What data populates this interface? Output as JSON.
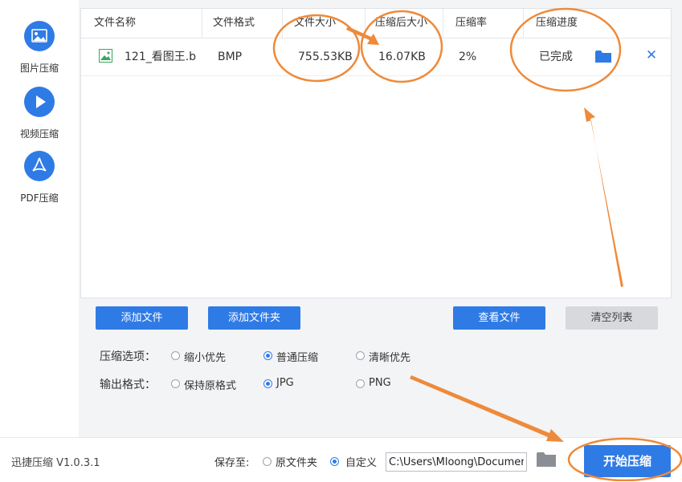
{
  "sidebar": {
    "items": [
      {
        "label": "图片压缩",
        "icon": "image-icon",
        "active": true
      },
      {
        "label": "视频压缩",
        "icon": "play-icon"
      },
      {
        "label": "PDF压缩",
        "icon": "pdf-icon"
      }
    ]
  },
  "table": {
    "headers": [
      "文件名称",
      "文件格式",
      "文件大小",
      "压缩后大小",
      "压缩率",
      "压缩进度"
    ],
    "rows": [
      {
        "name": "121_看图王.b",
        "format": "BMP",
        "size": "755.53KB",
        "compressed_size": "16.07KB",
        "ratio": "2%",
        "status": "已完成"
      }
    ]
  },
  "buttons": {
    "add_file": "添加文件",
    "add_folder": "添加文件夹",
    "view_files": "查看文件",
    "clear_list": "清空列表"
  },
  "options": {
    "compress_label": "压缩选项：",
    "compress_choices": [
      "缩小优先",
      "普通压缩",
      "清晰优先"
    ],
    "compress_selected": "普通压缩",
    "format_label": "输出格式：",
    "format_choices": [
      "保持原格式",
      "JPG",
      "PNG"
    ],
    "format_selected": "JPG"
  },
  "footer": {
    "version": "迅捷压缩 V1.0.3.1",
    "save_to_label": "保存至:",
    "save_choices": [
      "原文件夹",
      "自定义"
    ],
    "save_selected": "自定义",
    "path_value": "C:\\Users\\Mloong\\Documents",
    "start_button": "开始压缩"
  },
  "colors": {
    "accent": "#2f7be6",
    "annotation": "#ee8a3a"
  }
}
